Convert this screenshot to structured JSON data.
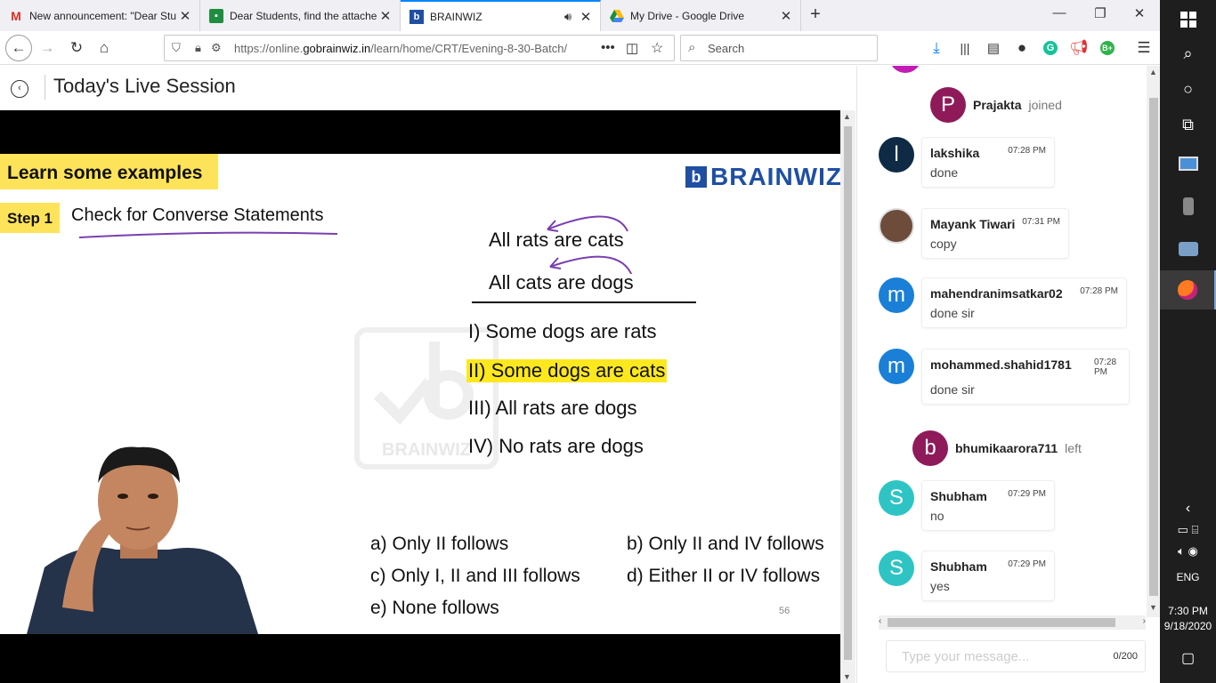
{
  "browser": {
    "tabs": [
      {
        "title": "New announcement: \"Dear Stu",
        "favicon": "gmail-icon"
      },
      {
        "title": "Dear Students, find the attache",
        "favicon": "classroom-icon"
      },
      {
        "title": "BRAINWIZ",
        "favicon": "brainwiz-icon",
        "active": true,
        "audio": true
      },
      {
        "title": "My Drive - Google Drive",
        "favicon": "drive-icon"
      }
    ],
    "url_prefix": "https://online.",
    "url_domain": "gobrainwiz.in",
    "url_path": "/learn/home/CRT/Evening-8-30-Batch/",
    "search_placeholder": "Search"
  },
  "page": {
    "title": "Today's Live Session"
  },
  "slide": {
    "heading": "Learn some examples",
    "step_badge": "Step 1",
    "step_text": "Check for Converse Statements",
    "logo_text": "BRAINWIZ",
    "watermark_text": "BRAINWIZ",
    "statements": [
      "All rats are cats",
      "All cats are dogs"
    ],
    "conclusions": [
      "I) Some dogs are rats",
      "II) Some dogs are cats",
      "III) All rats are dogs",
      "IV) No rats are dogs"
    ],
    "options": [
      "a) Only II follows",
      "b) Only II and IV follows",
      "c) Only I, II and III follows",
      "d) Either II or IV follows",
      "e) None follows"
    ],
    "page_number": "56",
    "highlight_color": "#fde820"
  },
  "chat": {
    "events": [
      {
        "avatar": "P",
        "name": "Prajakta",
        "action": "joined",
        "color": "#8e1a5a"
      },
      {
        "avatar": "b",
        "name": "bhumikaarora711",
        "action": "left",
        "color": "#8e1a5a"
      }
    ],
    "messages": [
      {
        "avatar": "l",
        "name": "lakshika",
        "time": "07:28 PM",
        "text": "done",
        "color": "#0f2a45"
      },
      {
        "avatar": "",
        "name": "Mayank Tiwari",
        "time": "07:31 PM",
        "text": "copy",
        "color": "#6d4c3c"
      },
      {
        "avatar": "m",
        "name": "mahendranimsatkar02",
        "time": "07:28 PM",
        "text": "done sir",
        "color": "#1a7fd6"
      },
      {
        "avatar": "m",
        "name": "mohammed.shahid1781",
        "time": "07:28 PM",
        "text": "done sir",
        "color": "#1a7fd6"
      },
      {
        "avatar": "S",
        "name": "Shubham",
        "time": "07:29 PM",
        "text": "no",
        "color": "#2fc4c4"
      },
      {
        "avatar": "S",
        "name": "Shubham",
        "time": "07:29 PM",
        "text": "yes",
        "color": "#2fc4c4"
      }
    ],
    "input_placeholder": "Type your message...",
    "char_count": "0/200"
  },
  "taskbar": {
    "lang": "ENG",
    "time": "7:30 PM",
    "date": "9/18/2020"
  }
}
